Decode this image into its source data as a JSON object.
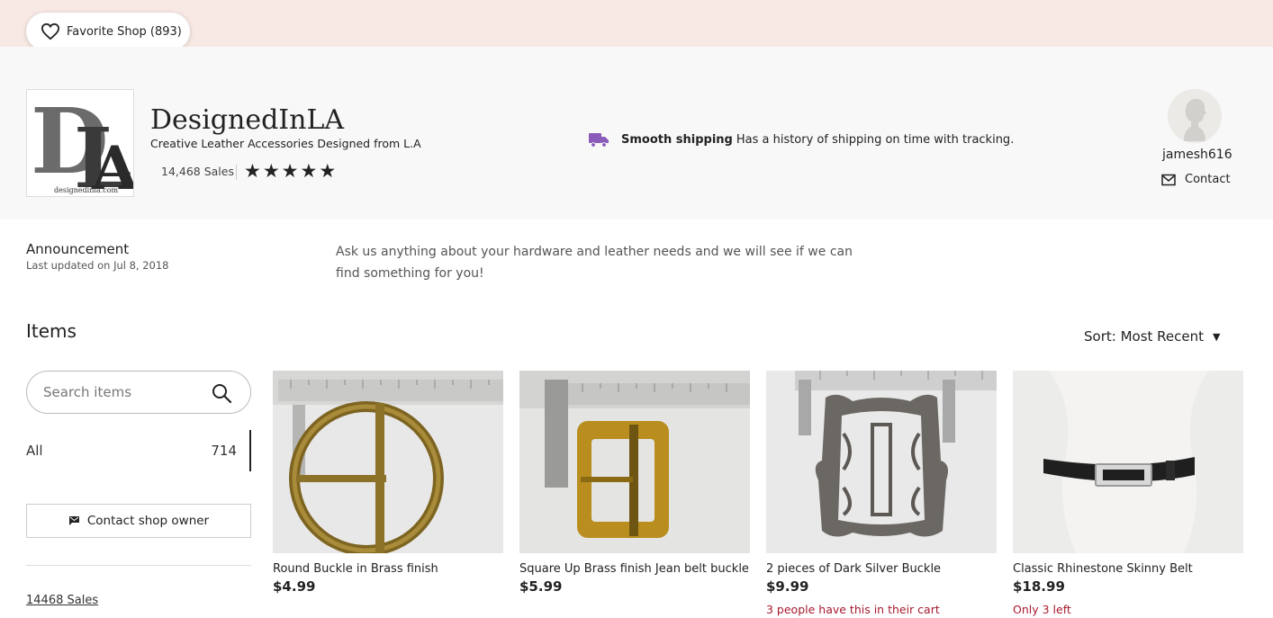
{
  "favorite": {
    "label": "Favorite Shop (893)"
  },
  "shop": {
    "name": "DesignedInLA",
    "tagline": "Creative Leather Accessories Designed from L.A",
    "sales": "14,468 Sales",
    "rating": 5,
    "stars": [
      "★",
      "★",
      "★",
      "★",
      "★"
    ],
    "logo_letters": "DLA",
    "logo_url_text": "designedinla.com"
  },
  "shipping": {
    "icon": "truck-icon",
    "title": "Smooth shipping",
    "text": "Has a history of shipping on time with tracking.",
    "icon_color": "#8a5bb8"
  },
  "owner": {
    "name": "jamesh616",
    "contact_label": "Contact"
  },
  "announcement": {
    "title": "Announcement",
    "updated": "Last updated on Jul 8, 2018",
    "text": "Ask us anything about your hardware and leather needs and we will see if we can find something for you!"
  },
  "items": {
    "title": "Items",
    "sort_label": "Sort: Most Recent",
    "search_placeholder": "Search items",
    "filters": [
      {
        "label": "All",
        "count": "714"
      }
    ],
    "contact_owner_label": "Contact shop owner",
    "sales_link": "14468 Sales"
  },
  "listings": [
    {
      "title": "Round Buckle in Brass finish",
      "price": "$4.99",
      "note": ""
    },
    {
      "title": "Square Up Brass finish Jean belt buckle",
      "price": "$5.99",
      "note": ""
    },
    {
      "title": "2 pieces of Dark Silver Buckle",
      "price": "$9.99",
      "note": "3 people have this in their cart"
    },
    {
      "title": "Classic Rhinestone Skinny Belt",
      "price": "$18.99",
      "note": "Only 3 left"
    }
  ],
  "colors": {
    "banner": "#f8e9e4",
    "header_bg": "#f8f8f8",
    "alert": "#a61a2e"
  }
}
